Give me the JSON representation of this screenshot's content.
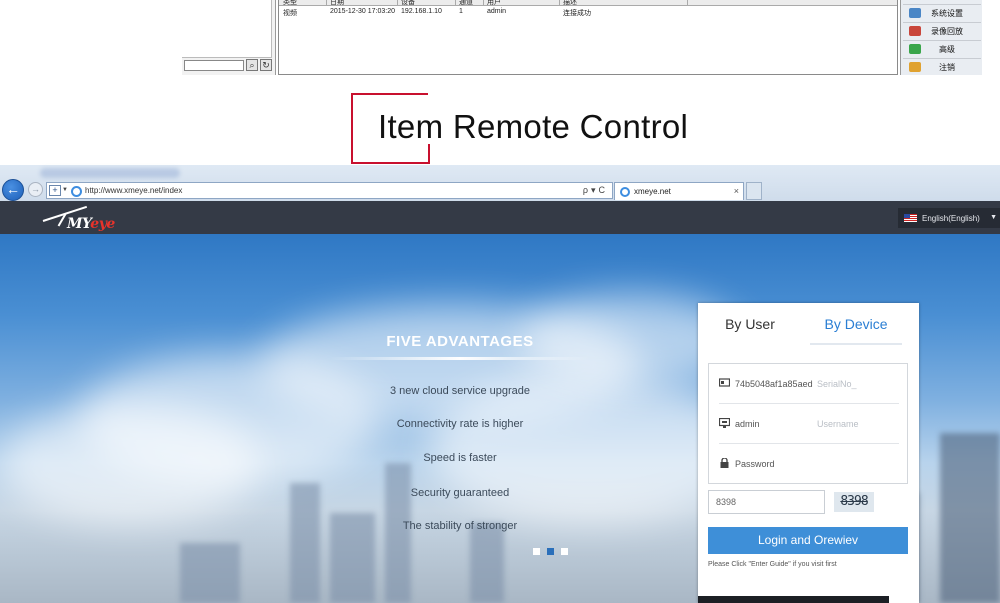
{
  "legacy": {
    "table_headers": [
      "类型",
      "日期",
      "设备",
      "通道",
      "用户",
      "描述"
    ],
    "row": [
      "视频",
      "2015-12-30 17:03:20",
      "192.168.1.10",
      "1",
      "admin",
      "连接成功"
    ],
    "side_menu": [
      "系统设置",
      "录像回放",
      "高级",
      "注销"
    ]
  },
  "heading": "Item Remote Control",
  "browser": {
    "url": "http://www.xmeye.net/index",
    "tab_title": "xmeye.net",
    "tools": "ρ▾C",
    "tab_close": "×"
  },
  "site": {
    "logo_prefix": "MY",
    "logo_suffix": "eye",
    "language": "English(English)"
  },
  "hero": {
    "title": "FIVE ADVANTAGES",
    "items": [
      "3 new cloud service upgrade",
      "Connectivity rate is higher",
      "Speed is faster",
      "Security guaranteed",
      "The stability of stronger"
    ]
  },
  "login": {
    "tab_user": "By User",
    "tab_device": "By Device",
    "serial_value": "74b5048af1a85aed",
    "serial_placeholder": "SerialNo_",
    "username_value": "admin",
    "username_placeholder": "Username",
    "password_placeholder": "Password",
    "captcha_value": "8398",
    "captcha_code": "8398",
    "button": "Login and Orewiev",
    "hint": "Please Click \"Enter Guide\" if you visit first"
  },
  "colors": {
    "accent": "#3e8fd8",
    "nav_bg": "#343a46",
    "heading_frame": "#c8102e"
  }
}
